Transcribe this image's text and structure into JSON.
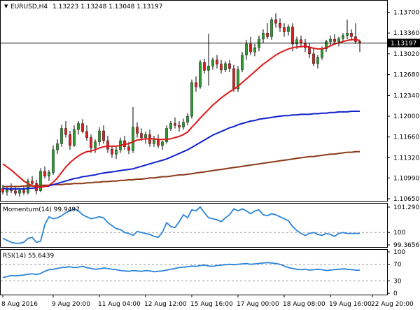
{
  "colors": {
    "background": "#ffffff",
    "frame": "#000000",
    "bull": "#2e9a2e",
    "bear": "#dd1f1f",
    "wick": "#000000",
    "ma_fast": "#e01818",
    "ma_mid": "#1122cc",
    "ma_slow": "#8b3a1a",
    "indicator": "#2c84d8",
    "level": "#9a9a9a"
  },
  "chart_data": [
    {
      "type": "candlestick",
      "title": "EURUSD,H4",
      "ohlc_label": "1.13223 1.13248 1.13048 1.13197",
      "price_tag": "1.13197",
      "current_price": 1.13197,
      "ylim": [
        1.1065,
        1.1374
      ],
      "yticks": [
        "1.13700",
        "1.13360",
        "1.13020",
        "1.12680",
        "1.12340",
        "1.12000",
        "1.11660",
        "1.11320",
        "1.10990",
        "1.10650"
      ],
      "ytick_values": [
        1.137,
        1.1336,
        1.1302,
        1.1268,
        1.1234,
        1.12,
        1.1166,
        1.1132,
        1.1099,
        1.1065
      ],
      "candles": [
        [
          1.1082,
          1.1088,
          1.1072,
          1.1076
        ],
        [
          1.1076,
          1.1085,
          1.107,
          1.108
        ],
        [
          1.108,
          1.109,
          1.1074,
          1.1078
        ],
        [
          1.1078,
          1.1084,
          1.107,
          1.1074
        ],
        [
          1.1074,
          1.1082,
          1.1068,
          1.1079
        ],
        [
          1.1079,
          1.1086,
          1.1071,
          1.1075
        ],
        [
          1.1075,
          1.1098,
          1.1072,
          1.1094
        ],
        [
          1.1094,
          1.1102,
          1.1085,
          1.109
        ],
        [
          1.109,
          1.1096,
          1.1072,
          1.1078
        ],
        [
          1.1078,
          1.1115,
          1.1076,
          1.111
        ],
        [
          1.111,
          1.1118,
          1.1098,
          1.1102
        ],
        [
          1.1102,
          1.1112,
          1.1094,
          1.1108
        ],
        [
          1.1108,
          1.1152,
          1.1104,
          1.1145
        ],
        [
          1.1145,
          1.1162,
          1.1138,
          1.1155
        ],
        [
          1.1155,
          1.1186,
          1.115,
          1.118
        ],
        [
          1.118,
          1.1192,
          1.1165,
          1.117
        ],
        [
          1.117,
          1.1176,
          1.1145,
          1.1152
        ],
        [
          1.1152,
          1.1185,
          1.115,
          1.1178
        ],
        [
          1.1178,
          1.1192,
          1.117,
          1.1188
        ],
        [
          1.1188,
          1.1195,
          1.1172,
          1.1175
        ],
        [
          1.1175,
          1.1185,
          1.116,
          1.1165
        ],
        [
          1.1165,
          1.117,
          1.114,
          1.1148
        ],
        [
          1.1148,
          1.1162,
          1.114,
          1.1158
        ],
        [
          1.1158,
          1.1182,
          1.1152,
          1.1176
        ],
        [
          1.1176,
          1.1185,
          1.1155,
          1.116
        ],
        [
          1.116,
          1.1168,
          1.114,
          1.1146
        ],
        [
          1.1146,
          1.115,
          1.1132,
          1.1138
        ],
        [
          1.1138,
          1.115,
          1.113,
          1.1145
        ],
        [
          1.1145,
          1.1165,
          1.114,
          1.116
        ],
        [
          1.116,
          1.1168,
          1.1145,
          1.115
        ],
        [
          1.115,
          1.1158,
          1.1138,
          1.1144
        ],
        [
          1.1144,
          1.1215,
          1.114,
          1.1182
        ],
        [
          1.1182,
          1.119,
          1.1165,
          1.1172
        ],
        [
          1.1172,
          1.118,
          1.116,
          1.1165
        ],
        [
          1.1165,
          1.1175,
          1.1155,
          1.117
        ],
        [
          1.117,
          1.1178,
          1.115,
          1.1155
        ],
        [
          1.1155,
          1.1168,
          1.115,
          1.1162
        ],
        [
          1.1162,
          1.117,
          1.1148,
          1.1152
        ],
        [
          1.1152,
          1.116,
          1.1145,
          1.1158
        ],
        [
          1.1158,
          1.1185,
          1.1155,
          1.118
        ],
        [
          1.118,
          1.1192,
          1.1176,
          1.1188
        ],
        [
          1.1188,
          1.1198,
          1.118,
          1.1185
        ],
        [
          1.1185,
          1.1192,
          1.1175,
          1.1182
        ],
        [
          1.1182,
          1.1196,
          1.1178,
          1.119
        ],
        [
          1.119,
          1.1205,
          1.1185,
          1.12
        ],
        [
          1.12,
          1.126,
          1.1196,
          1.1255
        ],
        [
          1.1255,
          1.1265,
          1.124,
          1.1248
        ],
        [
          1.1248,
          1.1292,
          1.1245,
          1.1288
        ],
        [
          1.1288,
          1.1294,
          1.127,
          1.1275
        ],
        [
          1.1275,
          1.1335,
          1.125,
          1.1282
        ],
        [
          1.1282,
          1.1296,
          1.1276,
          1.1292
        ],
        [
          1.1292,
          1.13,
          1.1278,
          1.1285
        ],
        [
          1.1285,
          1.1292,
          1.127,
          1.1276
        ],
        [
          1.1276,
          1.129,
          1.1272,
          1.1286
        ],
        [
          1.1286,
          1.1292,
          1.1272,
          1.1278
        ],
        [
          1.1278,
          1.1284,
          1.124,
          1.1245
        ],
        [
          1.1245,
          1.1282,
          1.124,
          1.1276
        ],
        [
          1.1276,
          1.1305,
          1.1272,
          1.13
        ],
        [
          1.13,
          1.1325,
          1.1292,
          1.1318
        ],
        [
          1.1318,
          1.133,
          1.13,
          1.1305
        ],
        [
          1.1305,
          1.1318,
          1.1298,
          1.1312
        ],
        [
          1.1312,
          1.1332,
          1.1306,
          1.1326
        ],
        [
          1.1326,
          1.1342,
          1.132,
          1.1336
        ],
        [
          1.1336,
          1.1352,
          1.1326,
          1.133
        ],
        [
          1.133,
          1.1362,
          1.1325,
          1.1358
        ],
        [
          1.1358,
          1.1368,
          1.1345,
          1.1352
        ],
        [
          1.1352,
          1.136,
          1.1338,
          1.1345
        ],
        [
          1.1345,
          1.1352,
          1.133,
          1.1338
        ],
        [
          1.1338,
          1.135,
          1.1332,
          1.1346
        ],
        [
          1.1346,
          1.1352,
          1.1306,
          1.1318
        ],
        [
          1.1318,
          1.133,
          1.131,
          1.1325
        ],
        [
          1.1325,
          1.1332,
          1.1312,
          1.132
        ],
        [
          1.132,
          1.1326,
          1.1305,
          1.1312
        ],
        [
          1.1312,
          1.132,
          1.1295,
          1.1302
        ],
        [
          1.1302,
          1.1312,
          1.1282,
          1.1286
        ],
        [
          1.1286,
          1.13,
          1.1278,
          1.1296
        ],
        [
          1.1296,
          1.1314,
          1.1292,
          1.131
        ],
        [
          1.131,
          1.1325,
          1.1305,
          1.1322
        ],
        [
          1.1322,
          1.1332,
          1.1314,
          1.1326
        ],
        [
          1.1326,
          1.1334,
          1.1318,
          1.1322
        ],
        [
          1.1322,
          1.133,
          1.1314,
          1.1327
        ],
        [
          1.1327,
          1.1336,
          1.1322,
          1.1332
        ],
        [
          1.1332,
          1.1358,
          1.1326,
          1.1336
        ],
        [
          1.1336,
          1.1342,
          1.1324,
          1.133
        ],
        [
          1.133,
          1.1352,
          1.1318,
          1.1322
        ],
        [
          1.1322,
          1.1325,
          1.1305,
          1.132
        ]
      ],
      "ma_fast": [
        1.1122,
        1.1117,
        1.1112,
        1.1106,
        1.11,
        1.1094,
        1.109,
        1.1086,
        1.1084,
        1.1084,
        1.1085,
        1.1087,
        1.1092,
        1.1099,
        1.1108,
        1.1117,
        1.1124,
        1.113,
        1.1135,
        1.1139,
        1.1142,
        1.1143,
        1.1145,
        1.1148,
        1.115,
        1.1151,
        1.1151,
        1.1151,
        1.1152,
        1.1154,
        1.1155,
        1.1158,
        1.1161,
        1.1162,
        1.1163,
        1.1163,
        1.1163,
        1.1162,
        1.1162,
        1.1162,
        1.1163,
        1.1165,
        1.1167,
        1.117,
        1.1174,
        1.1182,
        1.1189,
        1.1197,
        1.1204,
        1.1211,
        1.1218,
        1.1224,
        1.123,
        1.1235,
        1.124,
        1.1244,
        1.1249,
        1.1255,
        1.1261,
        1.1267,
        1.1273,
        1.1279,
        1.1285,
        1.129,
        1.1295,
        1.13,
        1.1304,
        1.1307,
        1.131,
        1.1312,
        1.1313,
        1.1314,
        1.1314,
        1.1313,
        1.1311,
        1.131,
        1.131,
        1.1312,
        1.1315,
        1.1318,
        1.132,
        1.1322,
        1.1324,
        1.1325,
        1.1325,
        1.1324
      ],
      "ma_mid": [
        1.1082,
        1.1081,
        1.1081,
        1.1081,
        1.1081,
        1.1081,
        1.1082,
        1.1082,
        1.1083,
        1.1084,
        1.1085,
        1.1086,
        1.1088,
        1.109,
        1.1092,
        1.1094,
        1.1096,
        1.1098,
        1.1099,
        1.1101,
        1.1102,
        1.1103,
        1.1104,
        1.1106,
        1.1107,
        1.1108,
        1.1109,
        1.111,
        1.1111,
        1.1112,
        1.1113,
        1.1114,
        1.1116,
        1.1118,
        1.112,
        1.1122,
        1.1124,
        1.1126,
        1.1128,
        1.113,
        1.1133,
        1.1136,
        1.1139,
        1.1142,
        1.1145,
        1.1149,
        1.1153,
        1.1157,
        1.1161,
        1.1165,
        1.1169,
        1.1172,
        1.1175,
        1.1178,
        1.1181,
        1.1183,
        1.1186,
        1.1188,
        1.119,
        1.1192,
        1.1193,
        1.1195,
        1.1196,
        1.1197,
        1.1198,
        1.1199,
        1.12,
        1.1201,
        1.1201,
        1.1202,
        1.1202,
        1.1203,
        1.1203,
        1.1203,
        1.1204,
        1.1204,
        1.1205,
        1.1205,
        1.1206,
        1.1206,
        1.1207,
        1.1207,
        1.1207,
        1.1208,
        1.1208,
        1.1208
      ],
      "ma_slow": [
        1.1085,
        1.1085,
        1.1085,
        1.1085,
        1.1085,
        1.1086,
        1.1086,
        1.1086,
        1.1086,
        1.1087,
        1.1087,
        1.1087,
        1.1088,
        1.1088,
        1.1088,
        1.1089,
        1.1089,
        1.109,
        1.109,
        1.109,
        1.1091,
        1.1091,
        1.1092,
        1.1092,
        1.1093,
        1.1093,
        1.1094,
        1.1094,
        1.1095,
        1.1095,
        1.1096,
        1.1096,
        1.1097,
        1.1097,
        1.1098,
        1.1099,
        1.1099,
        1.11,
        1.1101,
        1.1101,
        1.1102,
        1.1103,
        1.1104,
        1.1104,
        1.1105,
        1.1106,
        1.1107,
        1.1108,
        1.1109,
        1.111,
        1.1111,
        1.1112,
        1.1113,
        1.1114,
        1.1115,
        1.1116,
        1.1117,
        1.1118,
        1.1119,
        1.112,
        1.1121,
        1.1122,
        1.1123,
        1.1124,
        1.1125,
        1.1126,
        1.1127,
        1.1128,
        1.1129,
        1.113,
        1.1131,
        1.1132,
        1.1133,
        1.1134,
        1.1134,
        1.1135,
        1.1136,
        1.1137,
        1.1138,
        1.1138,
        1.1139,
        1.114,
        1.1141,
        1.1141,
        1.1142,
        1.1142
      ]
    },
    {
      "type": "line",
      "title": "Momentum(14) 99.9497",
      "ylim": [
        99.3656,
        101.2901
      ],
      "yticks": [
        "101.2901",
        "100",
        "99.3656"
      ],
      "ytick_values": [
        101.2901,
        100.0,
        99.3656
      ],
      "level": 100,
      "values": [
        99.7,
        99.6,
        99.5,
        99.45,
        99.45,
        99.5,
        99.7,
        99.75,
        99.5,
        99.55,
        100.4,
        100.8,
        100.7,
        100.75,
        100.85,
        101.0,
        101.1,
        101.2,
        101.1,
        100.9,
        100.8,
        100.7,
        100.75,
        100.8,
        100.75,
        100.5,
        100.35,
        100.2,
        100.15,
        100.0,
        99.95,
        99.85,
        100.05,
        100.0,
        99.95,
        99.9,
        99.8,
        99.75,
        100.0,
        100.5,
        100.3,
        100.25,
        100.55,
        100.9,
        100.75,
        101.15,
        101.1,
        101.3,
        101.0,
        100.75,
        100.7,
        100.65,
        100.55,
        100.75,
        100.9,
        101.2,
        101.1,
        101.2,
        101.1,
        100.95,
        101.1,
        101.15,
        100.9,
        100.85,
        100.95,
        100.9,
        100.8,
        100.7,
        100.6,
        100.3,
        100.1,
        99.95,
        99.85,
        99.95,
        100.0,
        99.9,
        99.85,
        99.95,
        99.9,
        99.8,
        99.95,
        100.0,
        99.95,
        99.95,
        99.95,
        99.95
      ]
    },
    {
      "type": "line",
      "title": "RSI(14) 55.6439",
      "ylim": [
        0,
        100
      ],
      "yticks": [
        "100",
        "70",
        "30",
        "0"
      ],
      "ytick_values": [
        100,
        70,
        30,
        0
      ],
      "levels": [
        70,
        30
      ],
      "values": [
        38,
        40,
        43,
        42,
        43,
        44,
        46,
        47,
        45,
        48,
        53,
        57,
        58,
        60,
        62,
        63,
        64,
        62,
        63,
        65,
        62,
        60,
        58,
        59,
        61,
        60,
        58,
        57,
        55,
        54,
        53,
        55,
        54,
        53,
        55,
        54,
        52,
        53,
        54,
        56,
        58,
        60,
        62,
        63,
        64,
        66,
        65,
        67,
        68,
        66,
        65,
        67,
        68,
        69,
        70,
        69,
        70,
        71,
        72,
        70,
        71,
        72,
        73,
        74,
        73,
        72,
        70,
        66,
        62,
        60,
        58,
        57,
        58,
        56,
        57,
        58,
        57,
        55,
        56,
        57,
        58,
        59,
        58,
        57,
        56,
        55.6
      ]
    }
  ],
  "time_axis": {
    "labels": [
      "8 Aug 2016",
      "9 Aug 20:00",
      "11 Aug 04:00",
      "12 Aug 12:00",
      "15 Aug 16:00",
      "17 Aug 00:00",
      "18 Aug 08:00",
      "19 Aug 16:00",
      "22 Aug 20:00"
    ],
    "label_bar_index": [
      0,
      12,
      23,
      34,
      45,
      56,
      67,
      78,
      88
    ]
  }
}
